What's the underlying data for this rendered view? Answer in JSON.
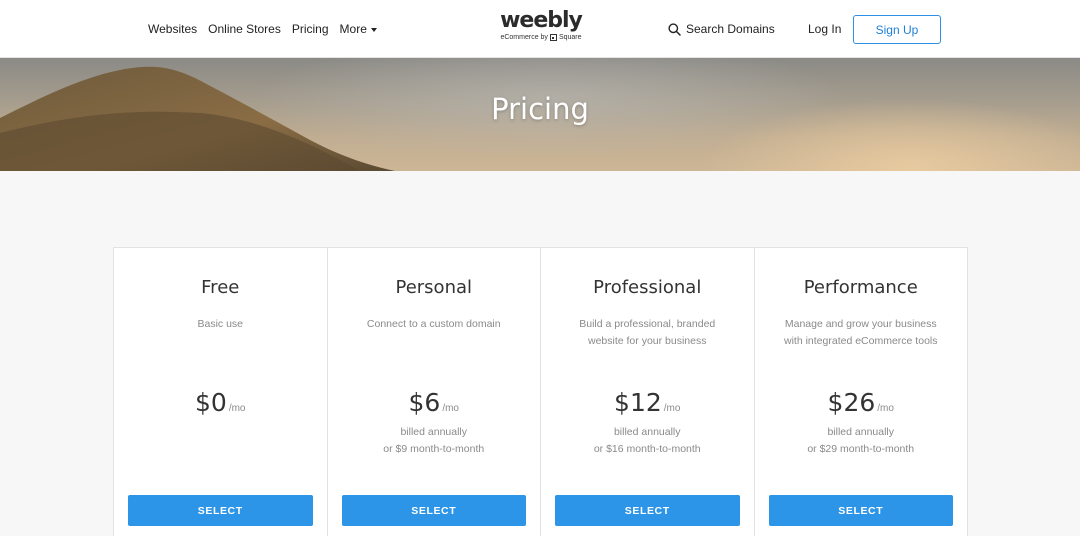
{
  "nav": {
    "links": [
      "Websites",
      "Online Stores",
      "Pricing",
      "More"
    ],
    "logo_word": "weebly",
    "logo_tagline_prefix": "eCommerce by",
    "logo_tagline_brand": "Square",
    "search_label": "Search Domains",
    "login_label": "Log In",
    "signup_label": "Sign Up"
  },
  "hero": {
    "title": "Pricing"
  },
  "plans": [
    {
      "name": "Free",
      "description": "Basic use",
      "price": "$0",
      "period": "/mo",
      "billing_line1": "",
      "billing_line2": "",
      "button": "SELECT"
    },
    {
      "name": "Personal",
      "description": "Connect to a custom domain",
      "price": "$6",
      "period": "/mo",
      "billing_line1": "billed annually",
      "billing_line2": "or $9 month-to-month",
      "button": "SELECT"
    },
    {
      "name": "Professional",
      "description": "Build a professional, branded website for your business",
      "price": "$12",
      "period": "/mo",
      "billing_line1": "billed annually",
      "billing_line2": "or $16 month-to-month",
      "button": "SELECT"
    },
    {
      "name": "Performance",
      "description": "Manage and grow your business with integrated eCommerce tools",
      "price": "$26",
      "period": "/mo",
      "billing_line1": "billed annually",
      "billing_line2": "or $29 month-to-month",
      "button": "SELECT"
    }
  ],
  "colors": {
    "accent": "#2c95e8",
    "signup_border": "#2f8ee6",
    "background": "#f7f7f7"
  },
  "icons": {
    "search": "search-icon",
    "more": "chevron-down-icon",
    "square_logo": "square-logo-icon"
  }
}
